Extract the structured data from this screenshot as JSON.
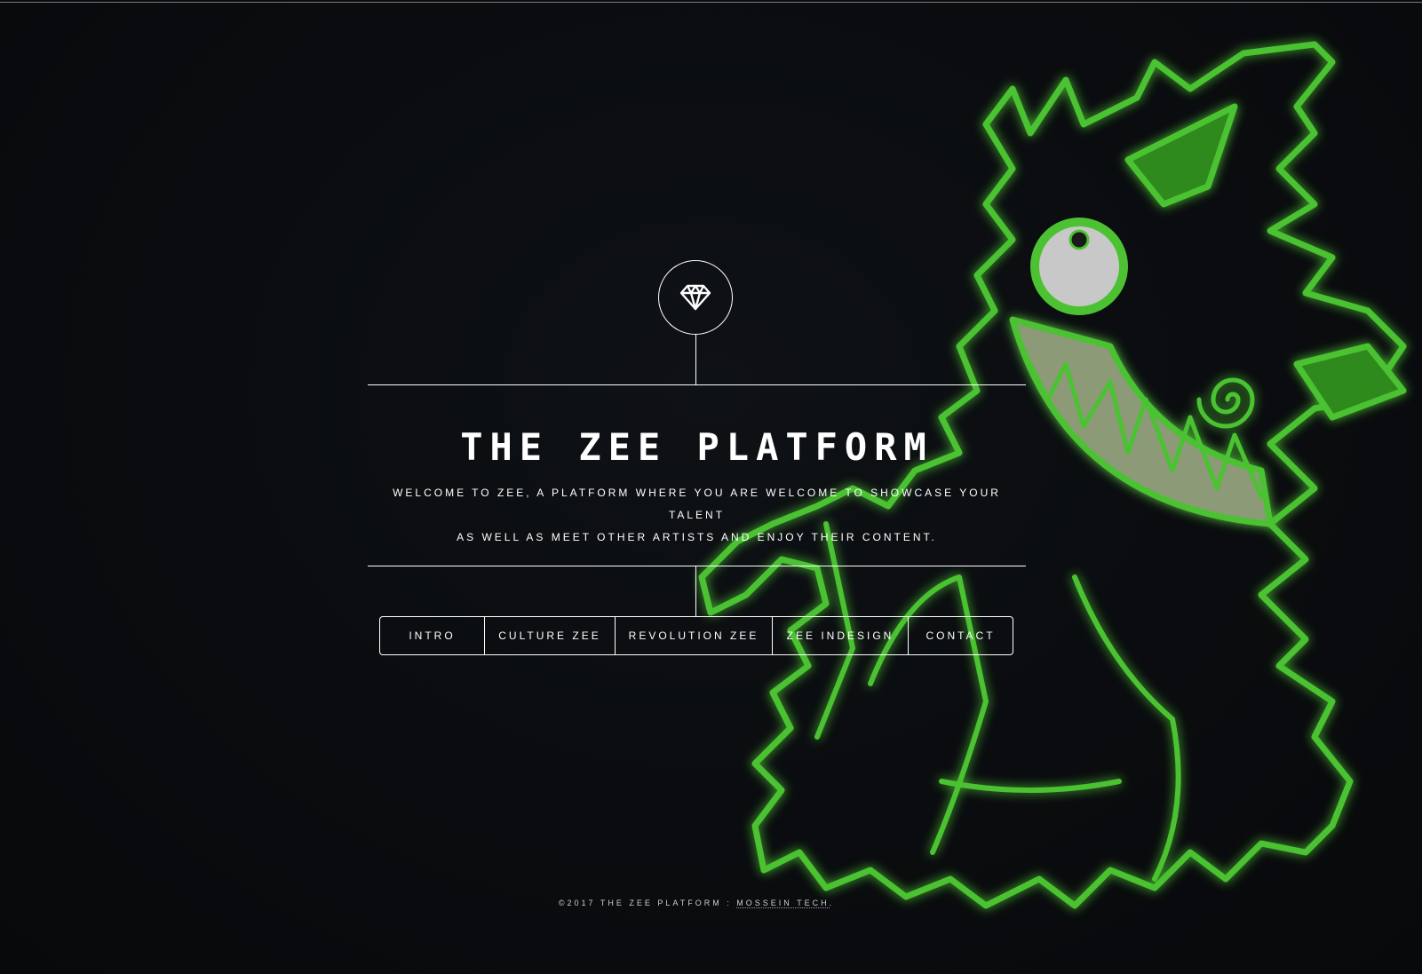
{
  "header": {
    "title": "THE ZEE PLATFORM",
    "subtitle_line1": "WELCOME TO ZEE, A PLATFORM WHERE YOU ARE WELCOME TO SHOWCASE YOUR TALENT",
    "subtitle_line2": "AS WELL AS MEET OTHER ARTISTS AND ENJOY THEIR CONTENT."
  },
  "logo": {
    "icon": "diamond-icon"
  },
  "nav": {
    "items": [
      {
        "label": "INTRO"
      },
      {
        "label": "CULTURE ZEE"
      },
      {
        "label": "REVOLUTION ZEE"
      },
      {
        "label": "ZEE INDESIGN"
      },
      {
        "label": "CONTACT"
      }
    ]
  },
  "footer": {
    "copyright": "©2017 THE ZEE PLATFORM : ",
    "link_label": "MOSSEIN TECH",
    "suffix": "."
  },
  "colors": {
    "background": "#0a0c0f",
    "foreground": "#ffffff",
    "mascot_green": "#3fae29"
  }
}
